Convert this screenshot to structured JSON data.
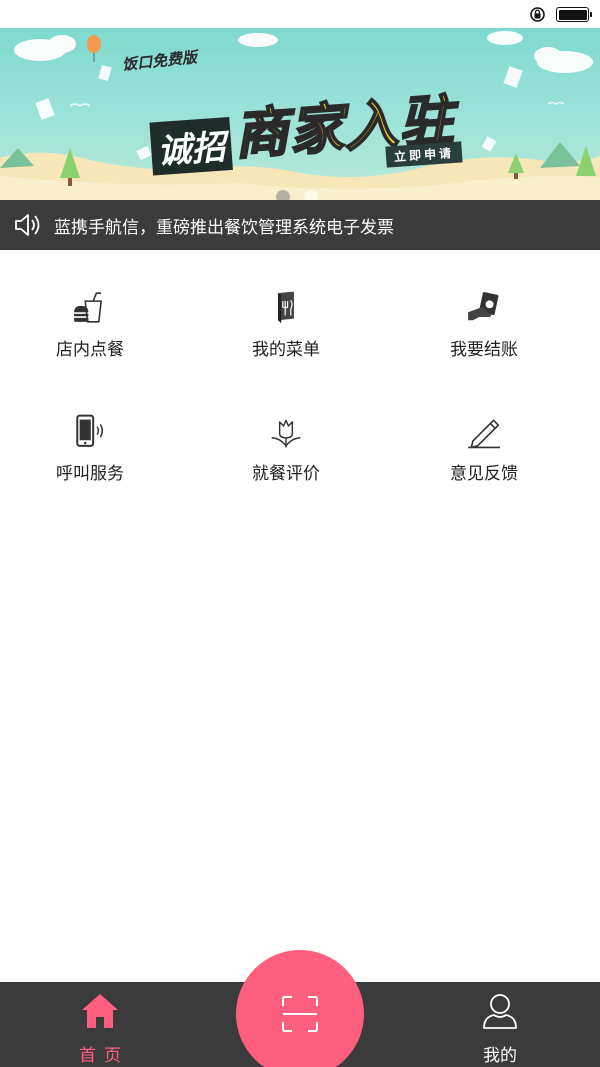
{
  "status_bar": {
    "icons": [
      "rotation-lock-icon",
      "battery-icon"
    ]
  },
  "banner": {
    "tag": "饭口免费版",
    "headline_small": "诚招",
    "headline_big": "商家入驻",
    "apply": "立即申请",
    "page_count": 2,
    "active_page": 1
  },
  "notice": {
    "icon": "speaker-icon",
    "text": "蓝携手航信，重磅推出餐饮管理系统电子发票"
  },
  "grid": {
    "items": [
      {
        "label": "店内点餐",
        "icon": "burger-drink-icon"
      },
      {
        "label": "我的菜单",
        "icon": "menu-book-icon"
      },
      {
        "label": "我要结账",
        "icon": "cash-payment-icon"
      },
      {
        "label": "呼叫服务",
        "icon": "phone-call-icon"
      },
      {
        "label": "就餐评价",
        "icon": "flower-icon"
      },
      {
        "label": "意见反馈",
        "icon": "pencil-icon"
      }
    ]
  },
  "tab_bar": {
    "home_label": "首页",
    "mine_label": "我的",
    "scan_icon": "scan-icon",
    "active_color": "#ff5f7e",
    "bar_color": "#3b3b3b"
  }
}
